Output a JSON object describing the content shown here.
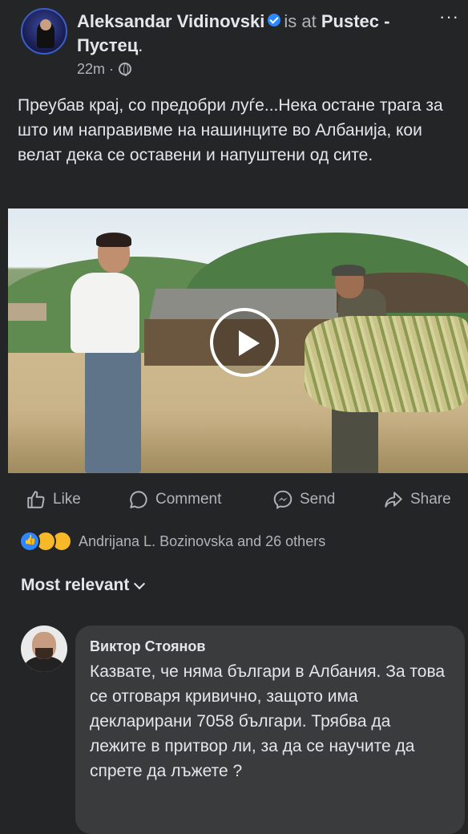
{
  "post": {
    "author": "Aleksandar Vidinovski",
    "is_at": "is at",
    "location": "Pustec - Пустец",
    "time": "22m",
    "more": "···",
    "text": "Преубав крај, со предобри луѓе...Нека остане трага за што им направивме на нашинците во Албанија, кои велат дека се оставени и напуштени од сите."
  },
  "actions": {
    "like": "Like",
    "comment": "Comment",
    "send": "Send",
    "share": "Share"
  },
  "reactions": {
    "summary": "Andrijana L. Bozinovska and 26 others",
    "types": [
      "like-icon",
      "haha-icon",
      "sad-icon"
    ]
  },
  "comments": {
    "sort_label": "Most relevant",
    "items": [
      {
        "author": "Виктор Стоянов",
        "text": "Казвате, че няма българи в Албания. За това се отговаря кривично, защото има декларирани 7058 българи. Трябва да лежите в притвор ли, за да се научите да спрете да лъжете ?"
      }
    ]
  },
  "colors": {
    "background": "#242526",
    "text": "#e4e6eb",
    "muted": "#b0b3b8",
    "bubble": "#3a3b3c",
    "verified": "#2d88ff"
  }
}
